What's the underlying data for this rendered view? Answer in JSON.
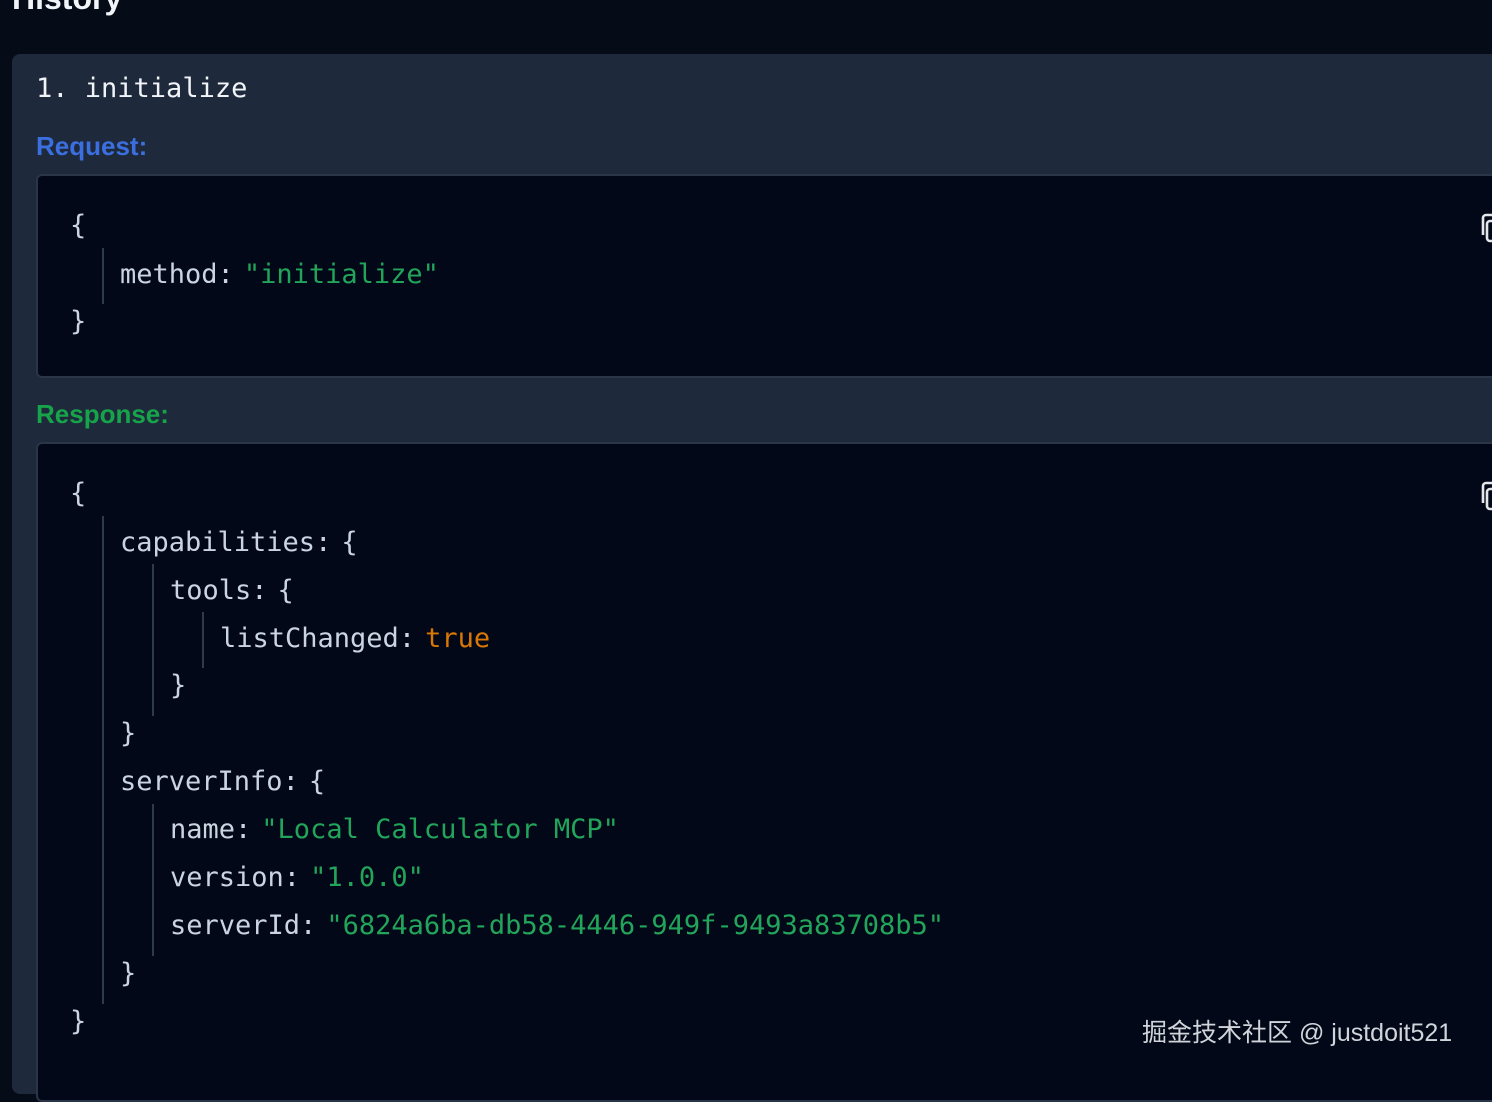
{
  "page": {
    "title": "History"
  },
  "entry": {
    "number": "1.",
    "method": "initialize",
    "request_label": "Request:",
    "response_label": "Response:"
  },
  "request": {
    "open_brace": "{",
    "close_brace": "}",
    "method_key": "method",
    "method_value": "\"initialize\""
  },
  "response": {
    "open_brace": "{",
    "close_brace": "}",
    "capabilities_key": "capabilities",
    "tools_key": "tools",
    "listChanged_key": "listChanged",
    "listChanged_value": "true",
    "serverInfo_key": "serverInfo",
    "name_key": "name",
    "name_value": "\"Local Calculator MCP\"",
    "version_key": "version",
    "version_value": "\"1.0.0\"",
    "serverId_key": "serverId",
    "serverId_value": "\"6824a6ba-db58-4446-949f-9493a83708b5\""
  },
  "symbols": {
    "colon": ":",
    "open": "{",
    "close": "}"
  },
  "icons": {
    "copy": "copy-icon"
  },
  "watermark": "掘金技术社区 @ justdoit521",
  "colors": {
    "background": "#050b17",
    "card": "#1e293b",
    "code_bg": "#020817",
    "request_label": "#3b6fe0",
    "response_label": "#16a34a",
    "string": "#22a55b",
    "boolean": "#d97706",
    "text": "#cbd5e1"
  }
}
